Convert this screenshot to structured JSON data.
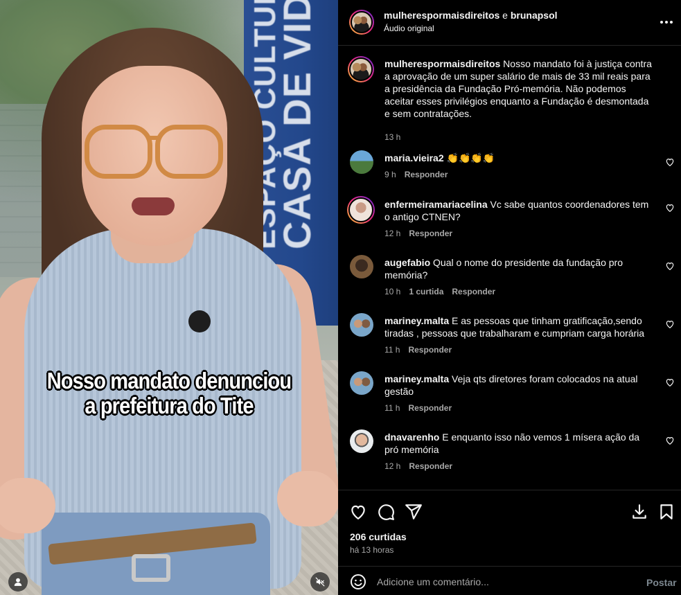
{
  "video": {
    "banner_line1": "ESPAÇO CULTURAL",
    "banner_line2": "CASA DE VIDRO",
    "caption_line1": "Nosso mandato denunciou",
    "caption_line2": "a prefeitura do Tite"
  },
  "header": {
    "author1": "mulherespormaisdireitos",
    "conjunction": "e",
    "author2": "brunapsol",
    "audio": "Áudio original"
  },
  "post": {
    "username": "mulherespormaisdireitos",
    "text": "Nosso mandato foi à justiça contra a aprovação de um super salário de mais de 33 mil reais para a presidência da Fundação Pró-memória. Não podemos aceitar esses privilégios enquanto a Fundação é desmontada e sem contratações.",
    "time": "13 h"
  },
  "comments": [
    {
      "username": "maria.vieira2",
      "text": "👏👏👏👏",
      "time": "9 h",
      "likes": "",
      "reply": "Responder"
    },
    {
      "username": "enfermeiramariacelina",
      "text": "Vc sabe quantos coordenadores tem o antigo CTNEN?",
      "time": "12 h",
      "likes": "",
      "reply": "Responder"
    },
    {
      "username": "augefabio",
      "text": "Qual o nome do presidente da fundação pro memória?",
      "time": "10 h",
      "likes": "1 curtida",
      "reply": "Responder"
    },
    {
      "username": "mariney.malta",
      "text": "E as pessoas que tinham gratificação,sendo tiradas , pessoas que trabalharam e cumpriam carga horária",
      "time": "11 h",
      "likes": "",
      "reply": "Responder"
    },
    {
      "username": "mariney.malta",
      "text": "Veja qts diretores foram colocados na atual gestão",
      "time": "11 h",
      "likes": "",
      "reply": "Responder"
    },
    {
      "username": "dnavarenho",
      "text": "E enquanto isso não vemos 1 mísera ação da pró memória",
      "time": "12 h",
      "likes": "",
      "reply": "Responder"
    }
  ],
  "actions": {
    "likes_count": "206 curtidas",
    "time_ago": "há 13 horas"
  },
  "composer": {
    "placeholder": "Adicione um comentário...",
    "post_label": "Postar"
  },
  "icons": {
    "more": "more-options-icon",
    "like": "heart-icon",
    "comment": "comment-icon",
    "share": "share-icon",
    "download": "download-icon",
    "save": "bookmark-icon",
    "emoji": "emoji-icon",
    "mute": "mute-icon",
    "tagged_user": "user-icon"
  }
}
